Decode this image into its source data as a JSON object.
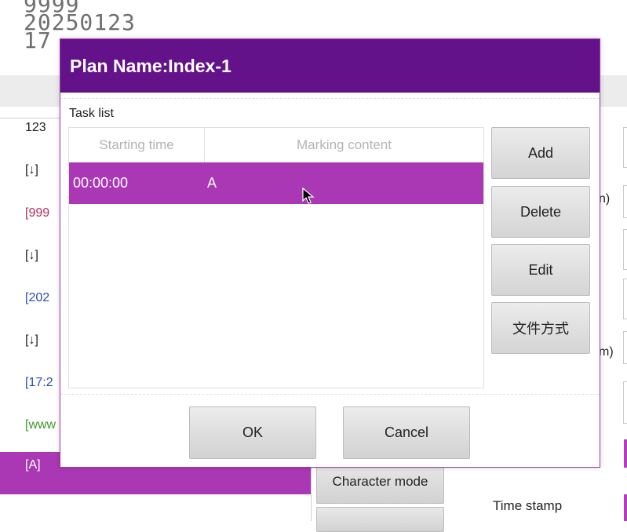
{
  "background": {
    "preview_lines": [
      "9999",
      "20250123",
      "17"
    ],
    "list_items": [
      {
        "text": "123",
        "color": "#222222"
      },
      {
        "text": "[↓]",
        "color": "#222222"
      },
      {
        "text": "[999",
        "color": "#b0305a"
      },
      {
        "text": "[↓]",
        "color": "#222222"
      },
      {
        "text": "[202",
        "color": "#2a4fb0"
      },
      {
        "text": "[↓]",
        "color": "#222222"
      },
      {
        "text": "[17:2",
        "color": "#2a4fb0"
      },
      {
        "text": "[www",
        "color": "#3c9a2a"
      }
    ],
    "selected_item": "[A]",
    "character_mode_label": "Character mode",
    "right_labels": [
      "n)",
      "m)"
    ],
    "time_stamp_label": "Time stamp"
  },
  "dialog": {
    "title": "Plan Name:Index-1",
    "task_list_label": "Task list",
    "columns": [
      "Starting time",
      "Marking content"
    ],
    "rows": [
      {
        "start_time": "00:00:00",
        "content": "A",
        "selected": true
      }
    ],
    "side_buttons": {
      "add": "Add",
      "delete": "Delete",
      "edit": "Edit",
      "file_mode": "文件方式"
    },
    "ok_label": "OK",
    "cancel_label": "Cancel"
  },
  "colors": {
    "title_bar": "#64128a",
    "selection": "#aa38b4"
  }
}
